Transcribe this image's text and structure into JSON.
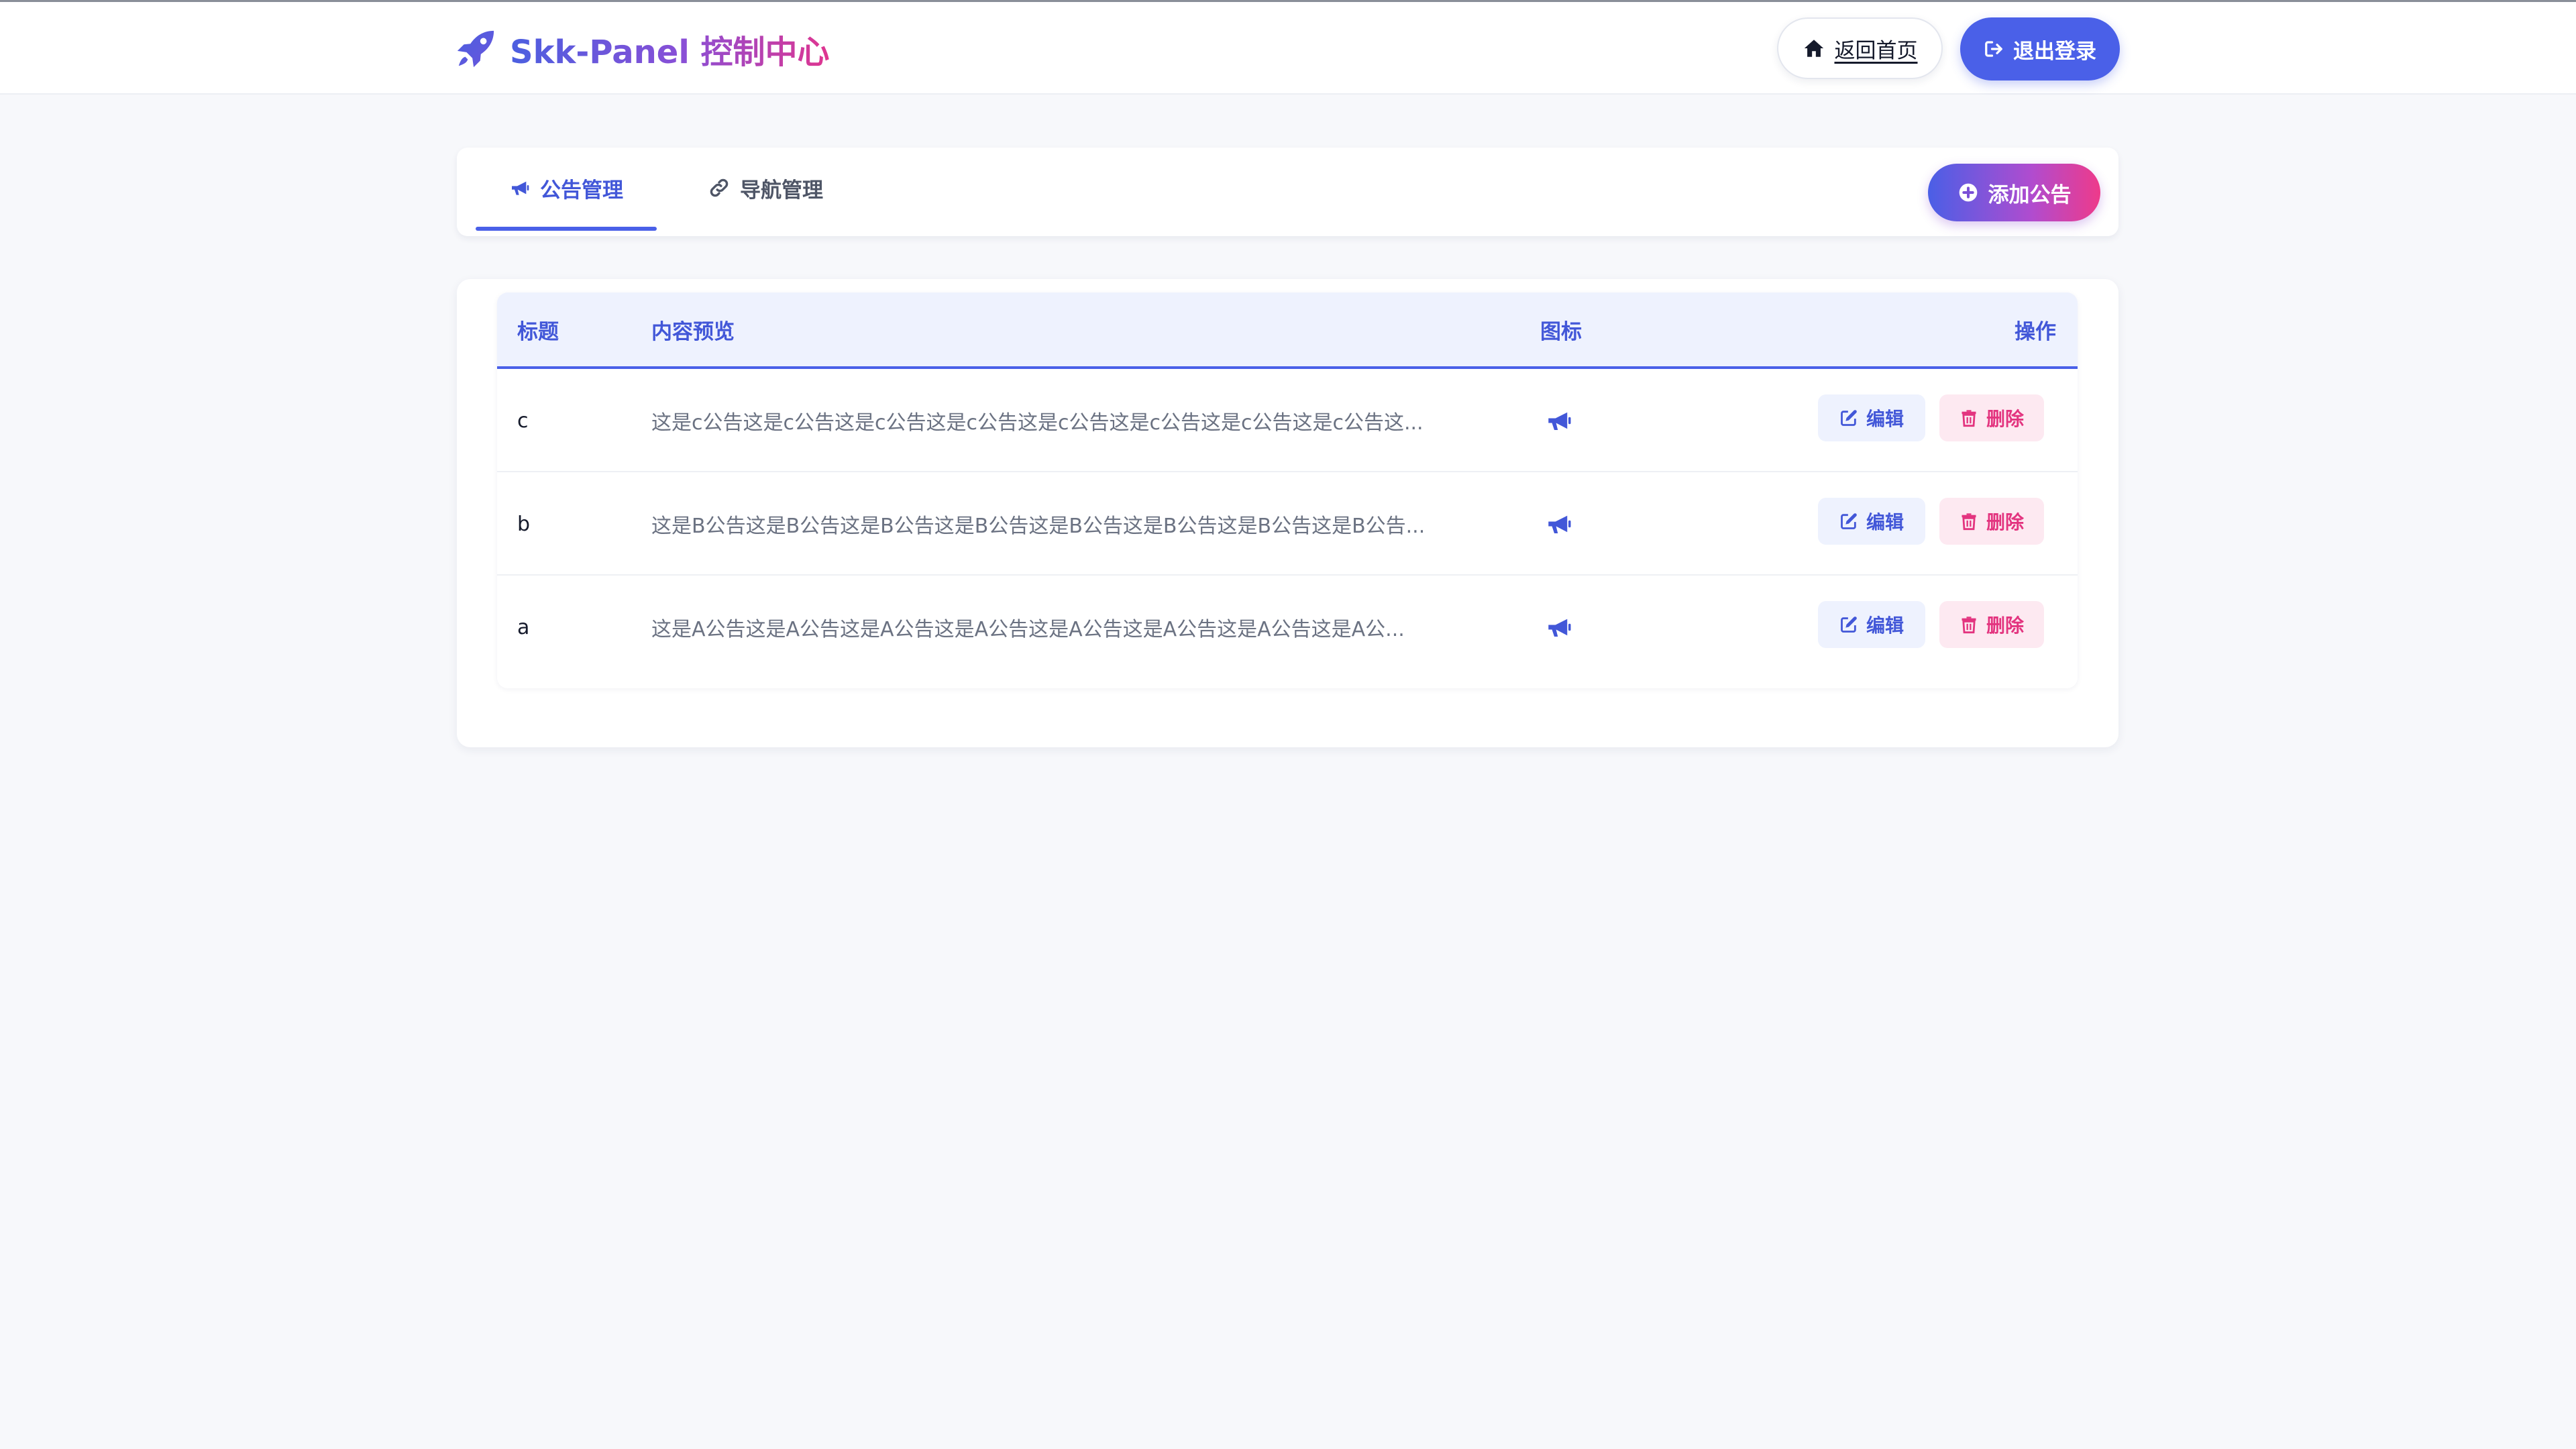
{
  "header": {
    "brand": "Skk-Panel 控制中心",
    "brand_icon": "rocket-icon",
    "home_button": "返回首页",
    "logout_button": "退出登录"
  },
  "tabs": [
    {
      "label": "公告管理",
      "icon": "megaphone-icon",
      "active": true
    },
    {
      "label": "导航管理",
      "icon": "link-icon",
      "active": false
    }
  ],
  "add_button": "添加公告",
  "table": {
    "columns": [
      "标题",
      "内容预览",
      "图标",
      "操作"
    ],
    "rows": [
      {
        "title": "c",
        "preview": "这是c公告这是c公告这是c公告这是c公告这是c公告这是c公告这是c公告这是c公告这...",
        "icon": "megaphone-icon",
        "edit": "编辑",
        "delete": "删除"
      },
      {
        "title": "b",
        "preview": "这是B公告这是B公告这是B公告这是B公告这是B公告这是B公告这是B公告这是B公告...",
        "icon": "megaphone-icon",
        "edit": "编辑",
        "delete": "删除"
      },
      {
        "title": "a",
        "preview": "这是A公告这是A公告这是A公告这是A公告这是A公告这是A公告这是A公告这是A公...",
        "icon": "megaphone-icon",
        "edit": "编辑",
        "delete": "删除"
      }
    ]
  },
  "colors": {
    "accent": "#4a60e8",
    "danger": "#e3347f",
    "gradient_start": "#4a5fe6",
    "gradient_end": "#ee3a8a"
  }
}
